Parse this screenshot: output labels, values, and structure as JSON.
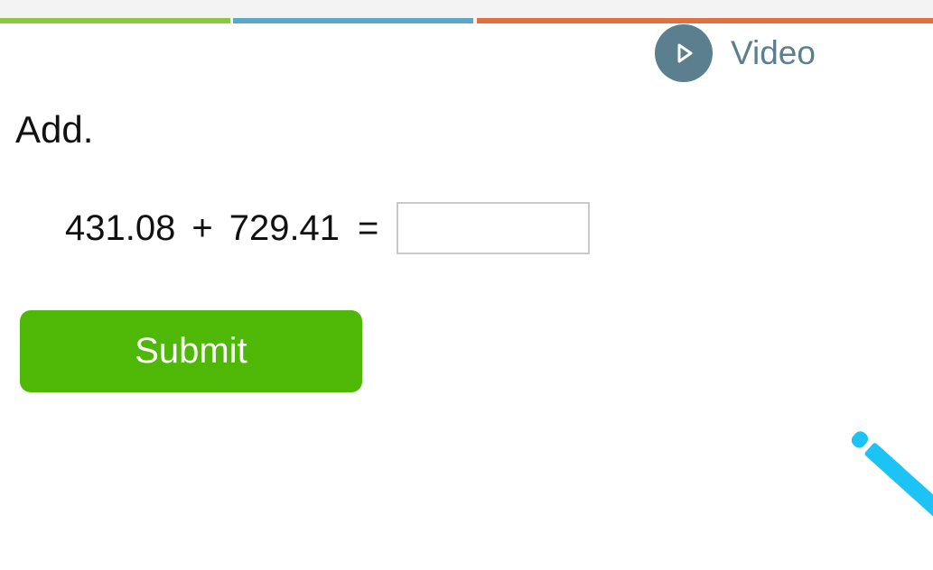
{
  "video": {
    "label": "Video",
    "icon": "play-icon",
    "color": "#5b7f8f"
  },
  "question": {
    "prompt": "Add.",
    "operand_a": "431.08",
    "operator": "+",
    "operand_b": "729.41",
    "equals": "=",
    "answer_value": ""
  },
  "submit": {
    "label": "Submit",
    "color": "#4fb706"
  },
  "tools": {
    "pencil_icon": "pencil-icon",
    "pencil_color": "#1ec3f5"
  },
  "stats_bar": {
    "colors": [
      "#8dc63f",
      "#5aa7c7",
      "#e07040"
    ]
  }
}
